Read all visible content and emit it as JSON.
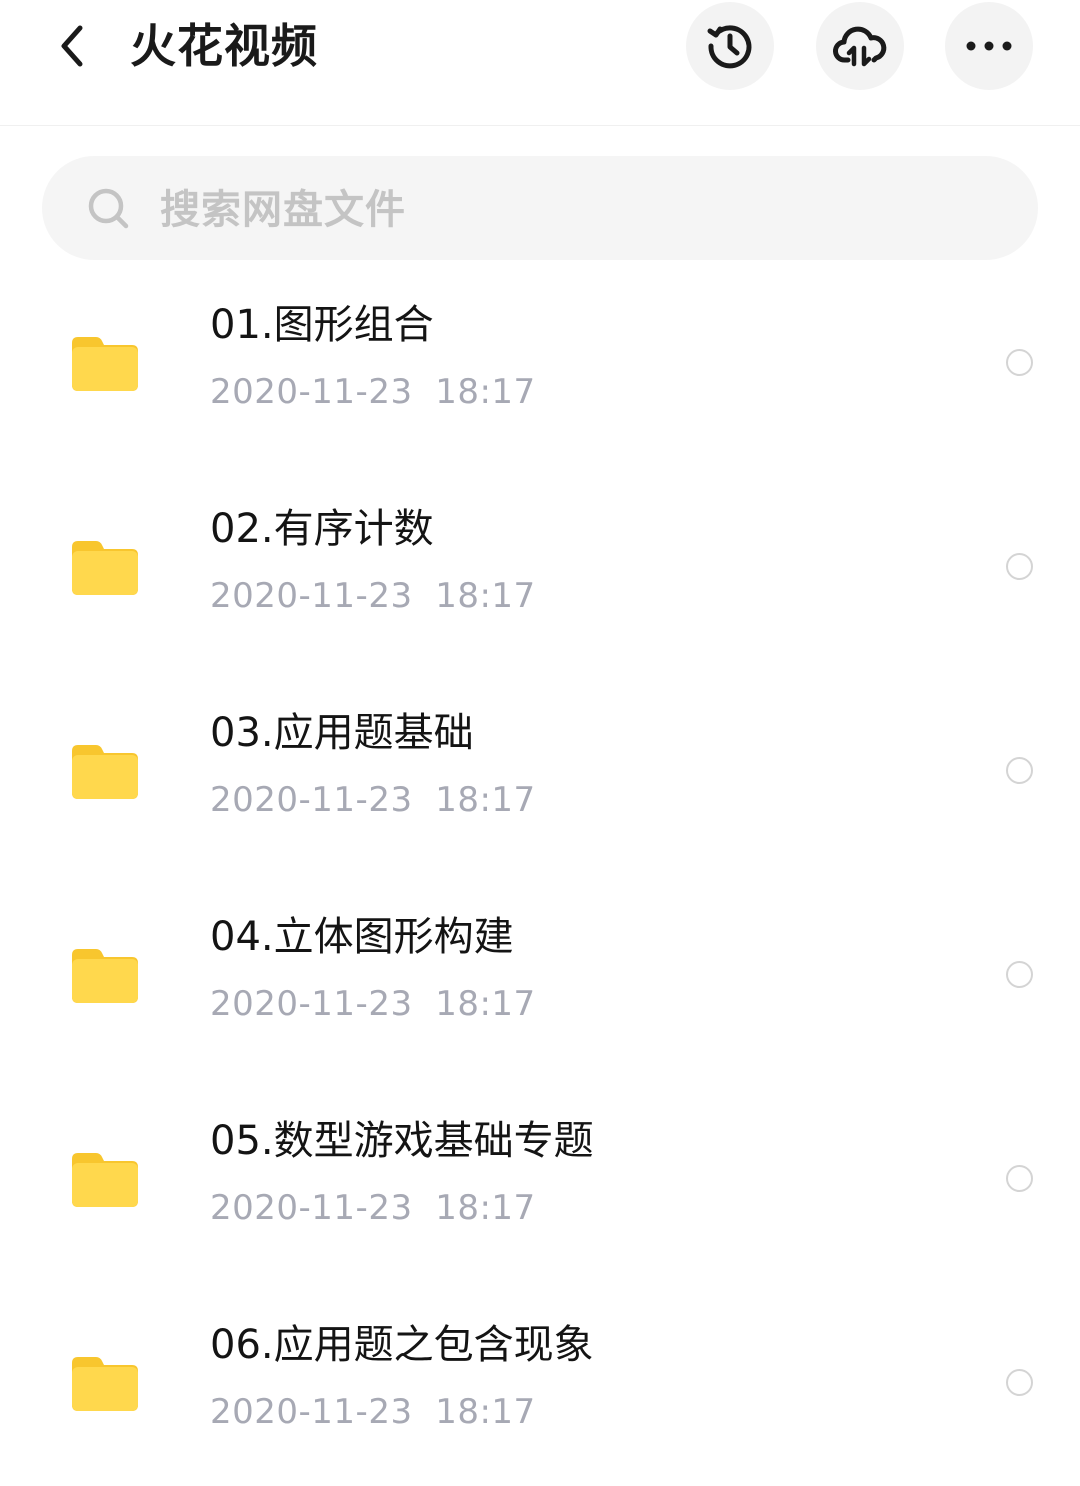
{
  "header": {
    "title": "火花视频",
    "icons": {
      "back": "back-chevron-icon",
      "history": "history-clock-icon",
      "cloud": "cloud-transfer-icon",
      "more": "more-dots-icon"
    }
  },
  "search": {
    "placeholder": "搜索网盘文件",
    "icon": "search-icon"
  },
  "files": [
    {
      "name": "01.图形组合",
      "date": "2020-11-23  18:17"
    },
    {
      "name": "02.有序计数",
      "date": "2020-11-23  18:17"
    },
    {
      "name": "03.应用题基础",
      "date": "2020-11-23  18:17"
    },
    {
      "name": "04.立体图形构建",
      "date": "2020-11-23  18:17"
    },
    {
      "name": "05.数型游戏基础专题",
      "date": "2020-11-23  18:17"
    },
    {
      "name": "06.应用题之包含现象",
      "date": "2020-11-23  18:17"
    }
  ],
  "colors": {
    "folder": "#FFD84D",
    "folder_tab": "#F8C62E",
    "title_text": "#1a1a1a",
    "date_text": "#a7a9b4",
    "placeholder_text": "#c4c4c4"
  }
}
